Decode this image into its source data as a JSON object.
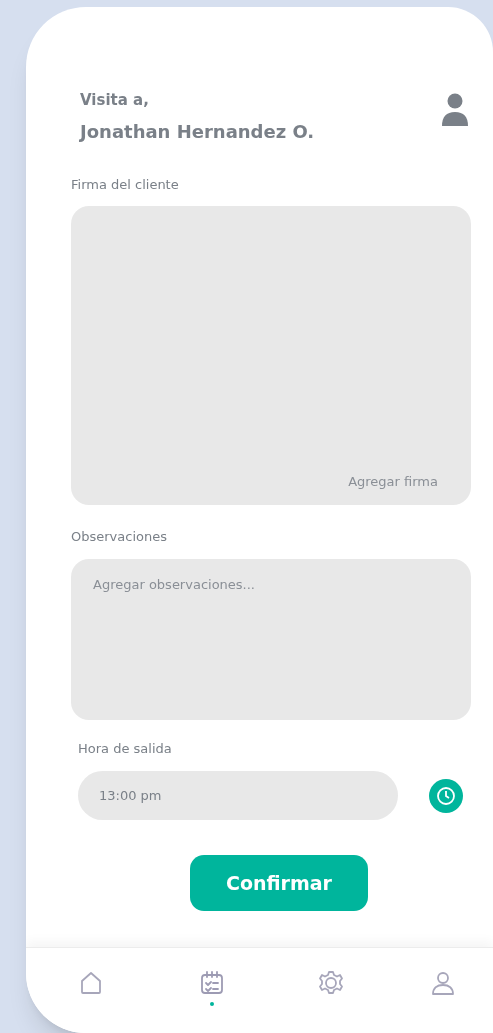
{
  "header": {
    "greeting": "Visita a,",
    "name": "Jonathan Hernandez O."
  },
  "signature": {
    "label": "Firma del cliente",
    "action": "Agregar firma"
  },
  "observations": {
    "label": "Observaciones",
    "placeholder": "Agregar observaciones..."
  },
  "departure": {
    "label": "Hora de salida",
    "value": "13:00 pm"
  },
  "confirm_button": "Confirmar",
  "nav": [
    {
      "kind": "home",
      "selected": false
    },
    {
      "kind": "calendar",
      "selected": true
    },
    {
      "kind": "settings",
      "selected": false
    },
    {
      "kind": "profile",
      "selected": false
    }
  ]
}
